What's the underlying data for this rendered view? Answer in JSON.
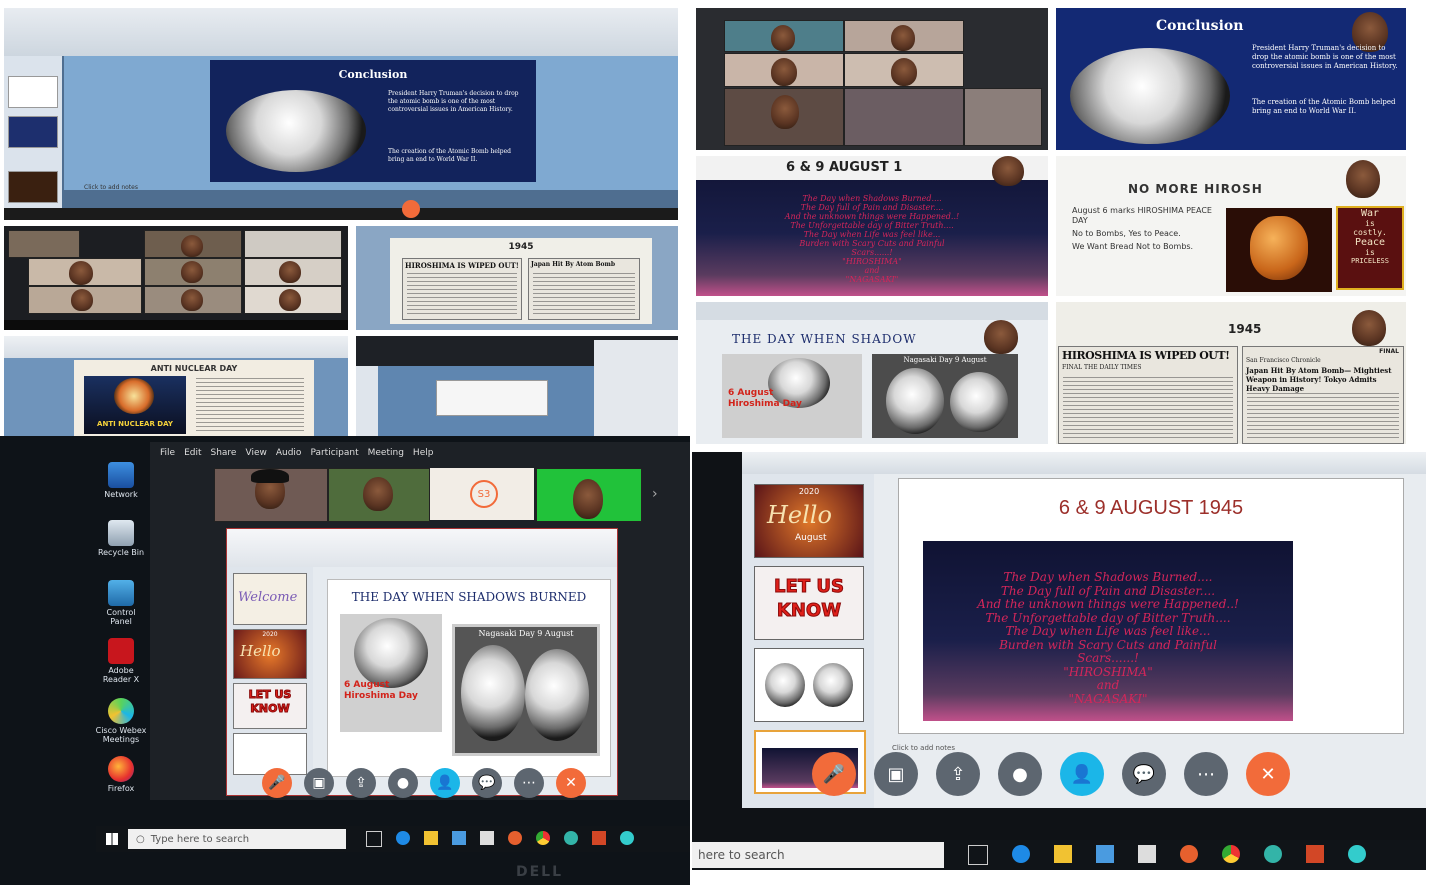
{
  "panels": {
    "top_left": {
      "slide_title": "Conclusion",
      "bullet1": "President Harry Truman's decision to drop the atomic bomb is one of the most controversial issues in American History.",
      "bullet2": "The creation of the Atomic Bomb helped bring an end to World War II.",
      "notes": "Click to add notes"
    },
    "mid_right_small": {
      "year": "1945",
      "headline": "HIROSHIMA IS WIPED OUT!",
      "headline2": "Japan Hit By Atom Bomb"
    },
    "bottom_left_small": {
      "slide_title": "ANTI NUCLEAR DAY",
      "banner": "ANTI NUCLEAR DAY"
    },
    "top_right": {
      "conclusion_title": "Conclusion",
      "bullet1": "President Harry Truman's decision to drop the atomic bomb is one of the most controversial issues in American History.",
      "bullet2": "The creation of the Atomic Bomb helped bring an end to World War II.",
      "date_title": "6 & 9 AUGUST 1",
      "poem_lines": [
        "The Day when Shadows Burned....",
        "The Day full of Pain and Disaster....",
        "And the unknown things were Happened..!",
        "The Unforgettable day of Bitter Truth....",
        "The Day when Life was feel like...",
        "Burden with Scary Cuts and Painful",
        "Scars......!",
        "\"HIROSHIMA\"",
        "and",
        "\"NAGASAKI\""
      ],
      "no_more_title": "NO MORE HIROSH",
      "no_more_bullets": [
        "August 6 marks HIROSHIMA PEACE DAY",
        "No to Bombs, Yes to Peace.",
        "We Want Bread Not to Bombs."
      ],
      "war_sign": [
        "War",
        "is",
        "costly.",
        "Peace",
        "is",
        "PRICELESS"
      ],
      "shadow_title": "THE DAY WHEN SHADOW",
      "hiroshima_caption": "6 August Hiroshima Day",
      "nagasaki_caption": "Nagasaki Day 9 August",
      "year": "1945",
      "headline": "HIROSHIMA IS WIPED OUT!",
      "chronicle": "San Francisco Chronicle",
      "final": "FINAL",
      "headline2": "Japan Hit By Atom Bomb— Mightiest Weapon in History! Tokyo Admits Heavy Damage",
      "daily_times": "FINAL THE DAILY TIMES"
    },
    "bottom_left": {
      "menu": [
        "File",
        "Edit",
        "Share",
        "View",
        "Audio",
        "Participant",
        "Meeting",
        "Help"
      ],
      "desktop_icons": [
        "Network",
        "Recycle Bin",
        "Control Panel",
        "Adobe Reader X",
        "Cisco Webex Meetings",
        "Firefox"
      ],
      "participant_badge": "S3",
      "slide_title": "THE DAY WHEN SHADOWS BURNED",
      "hiroshima_caption": "6 August Hiroshima Day",
      "nagasaki_caption": "Nagasaki Day 9 August",
      "thumb_welcome": "Welcome",
      "thumb_hello": "Hello",
      "thumb_year": "2020",
      "thumb_letus": "LET US KNOW",
      "search_placeholder": "Type here to search",
      "monitor_brand": "DELL"
    },
    "bottom_right": {
      "slide_title": "6 & 9 AUGUST 1945",
      "poem_lines": [
        "The Day when Shadows Burned....",
        "The Day full of Pain and Disaster....",
        "And the unknown things were Happened..!",
        "The Unforgettable day of Bitter Truth....",
        "The Day when Life was feel like...",
        "Burden with Scary Cuts and Painful",
        "Scars......!",
        "\"HIROSHIMA\"",
        "and",
        "\"NAGASAKI\""
      ],
      "thumb_year": "2020",
      "thumb_hello": "Hello",
      "thumb_august": "August",
      "thumb_letus": "LET US KNOW",
      "notes": "Click to add notes",
      "search_placeholder": "here to search"
    }
  },
  "colors": {
    "slide_navy": "#12235c",
    "poem_pink": "#d4265a",
    "webex_red": "#f26b3a",
    "webex_cyan": "#1bb6e8",
    "webex_gray": "#5d6670"
  }
}
